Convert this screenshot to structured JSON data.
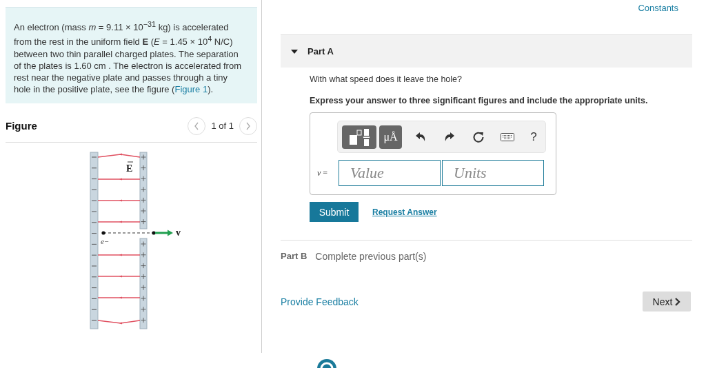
{
  "constants_link": "Constants",
  "problem": {
    "text_before": "An electron (mass *m* = 9.11 × 10$^{−31}$ kg) is accelerated from the rest in the uniform field **E** (*E* = 1.45 × 10$^{4}$ N/C) between two thin parallel charged plates. The separation of the plates is 1.60 cm . The electron is accelerated from rest near the negative plate and passes through a tiny hole in the positive plate, see the figure (",
    "figure_link": "Figure 1",
    "text_after": ")."
  },
  "figure": {
    "heading": "Figure",
    "pager": "1 of 1",
    "field_label": "E",
    "electron_label": "e−",
    "velocity_label": "v"
  },
  "part_a": {
    "label": "Part A",
    "expanded": true,
    "question": "With what speed does it leave the hole?",
    "instructions": "Express your answer to three significant figures and include the appropriate units.",
    "toolbar": [
      {
        "kind": "templates"
      },
      {
        "kind": "units",
        "text": "μÅ"
      },
      {
        "kind": "undo"
      },
      {
        "kind": "redo"
      },
      {
        "kind": "reset"
      },
      {
        "kind": "keyboard"
      },
      {
        "kind": "help",
        "text": "?"
      }
    ],
    "variable": "*v* =",
    "value_placeholder": "Value",
    "units_placeholder": "Units",
    "submit": "Submit",
    "request_answer": "Request Answer"
  },
  "part_b": {
    "label": "Part B",
    "status": "Complete previous part(s)"
  },
  "feedback_link": "Provide Feedback",
  "next_button": "Next"
}
